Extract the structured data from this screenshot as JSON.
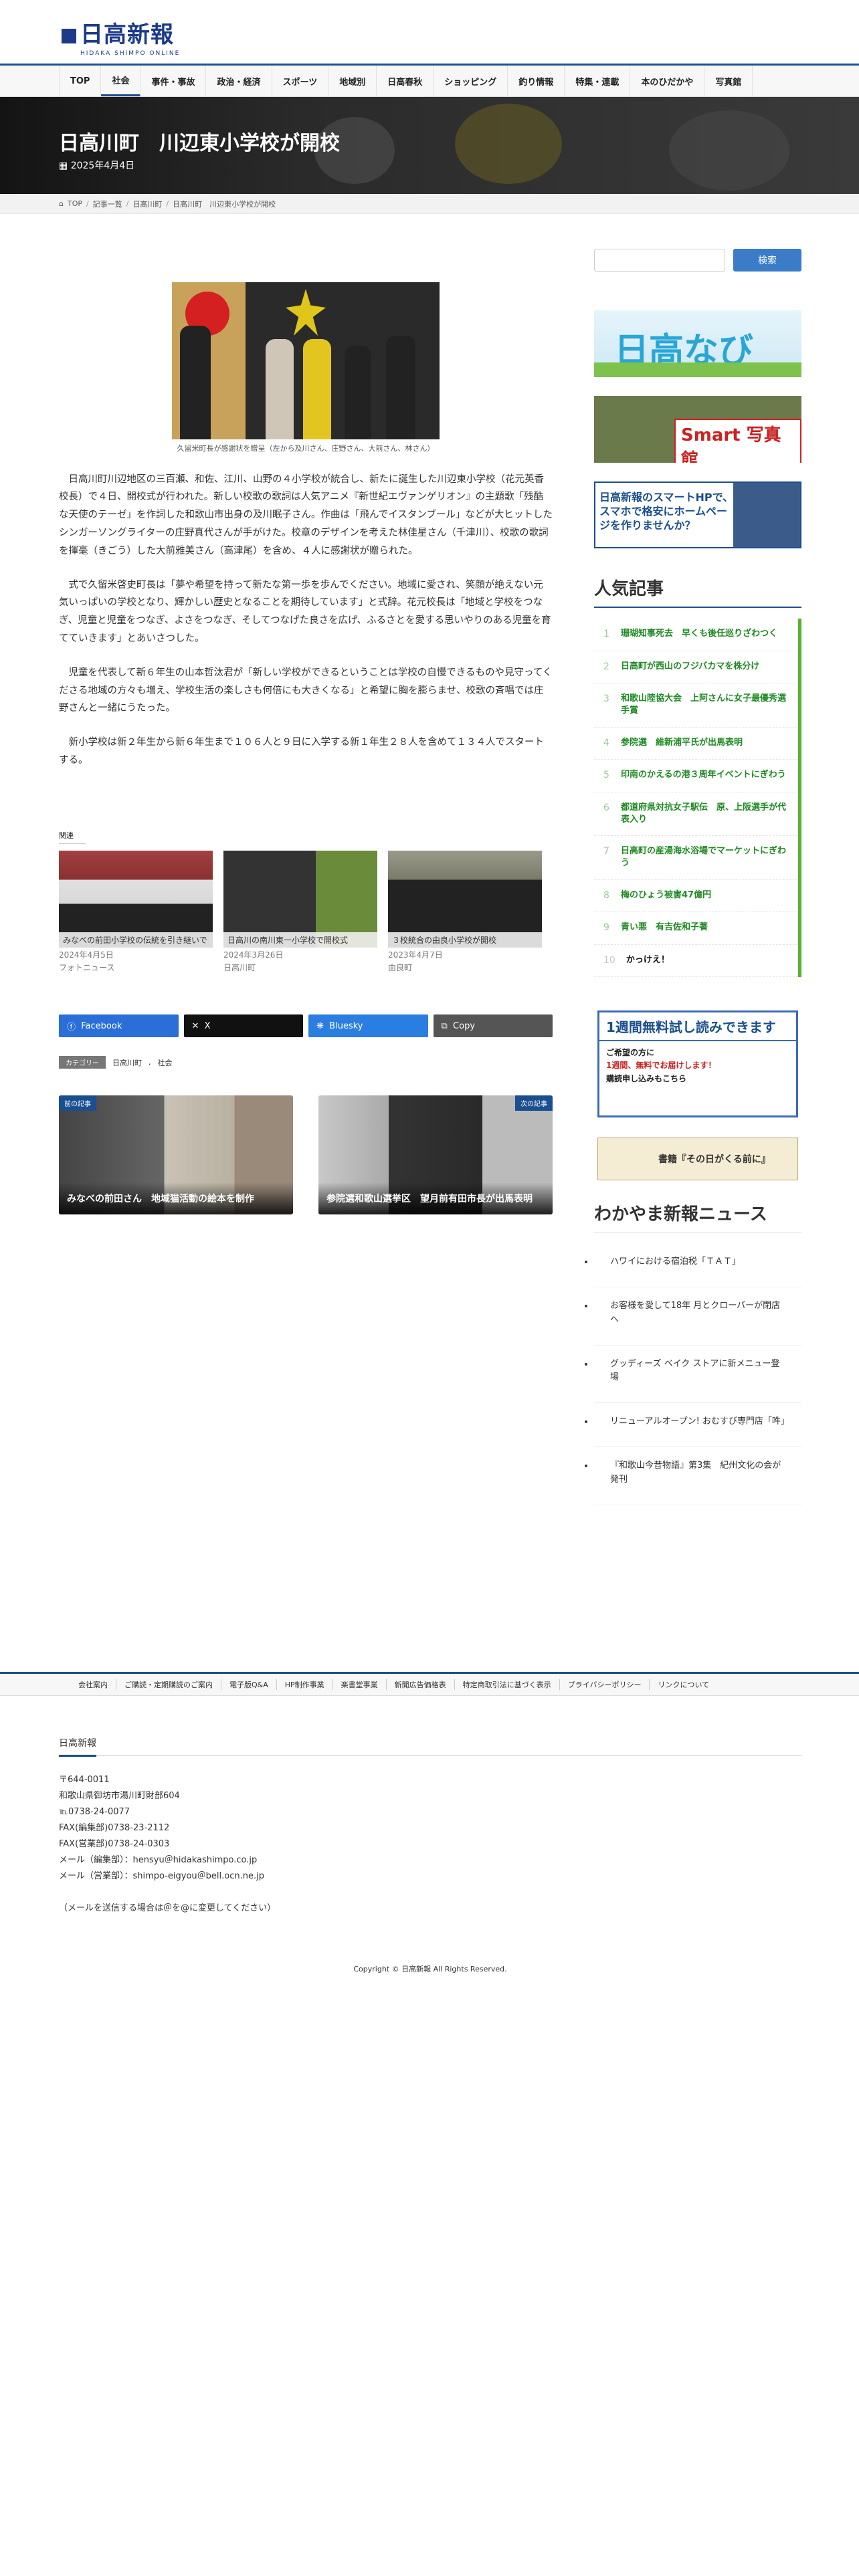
{
  "site": {
    "logo": "日高新報",
    "logo_sub": "HIDAKA SHIMPO ONLINE"
  },
  "nav": [
    "TOP",
    "社会",
    "事件・事故",
    "政治・経済",
    "スポーツ",
    "地域別",
    "日高春秋",
    "ショッピング",
    "釣り情報",
    "特集・連載",
    "本のひだかや",
    "写真館"
  ],
  "article": {
    "title": "日高川町　川辺東小学校が開校",
    "date": "2025年4月4日",
    "breadcrumb": [
      "TOP",
      "記事一覧",
      "日高川町",
      "日高川町　川辺東小学校が開校"
    ],
    "caption": "久留米町長が感謝状を贈呈（左から及川さん、庄野さん、大前さん、林さん）",
    "paragraphs": [
      "日高川町川辺地区の三百瀬、和佐、江川、山野の４小学校が統合し、新たに誕生した川辺東小学校（花元英香校長）で４日、開校式が行われた。新しい校歌の歌詞は人気アニメ『新世紀エヴァンゲリオン』の主題歌「残酷な天使のテーゼ」を作詞した和歌山市出身の及川眠子さん。作曲は「飛んでイスタンブール」などが大ヒットしたシンガーソングライターの庄野真代さんが手がけた。校章のデザインを考えた林佳星さん（千津川）、校歌の歌詞を揮毫（きごう）した大前雅美さん（高津尾）を含め、４人に感謝状が贈られた。",
      "式で久留米啓史町長は「夢や希望を持って新たな第一歩を歩んでください。地域に愛され、笑顔が絶えない元気いっぱいの学校となり、輝かしい歴史となることを期待しています」と式辞。花元校長は「地域と学校をつなぎ、児童と児童をつなぎ、よさをつなぎ、そしてつなげた良さを広げ、ふるさとを愛する思いやりのある児童を育てていきます」とあいさつした。",
      "児童を代表して新６年生の山本哲汰君が「新しい学校ができるということは学校の自慢できるものや見守ってくださる地域の方々も増え、学校生活の楽しさも何倍にも大きくなる」と希望に胸を膨らませ、校歌の斉唱では庄野さんと一緒にうたった。",
      "新小学校は新２年生から新６年生まで１０６人と９日に入学する新１年生２８人を含めて１３４人でスタートする。"
    ]
  },
  "related": {
    "heading": "関連",
    "items": [
      {
        "title": "みなべの前田小学校の伝統を引き継いで",
        "date": "2024年4月5日",
        "cat": "フォトニュース"
      },
      {
        "title": "日高川の南川東一小学校で開校式",
        "date": "2024年3月26日",
        "cat": "日高川町"
      },
      {
        "title": "３校統合の由良小学校が開校",
        "date": "2023年4月7日",
        "cat": "由良町"
      }
    ]
  },
  "share": [
    {
      "label": "Facebook",
      "color": "#2a6ed8",
      "icon": "facebook-icon"
    },
    {
      "label": "X",
      "color": "#111111",
      "icon": "x-icon"
    },
    {
      "label": "Bluesky",
      "color": "#2a7ee0",
      "icon": "bluesky-icon"
    },
    {
      "label": "Copy",
      "color": "#555555",
      "icon": "copy-icon"
    }
  ],
  "tags": {
    "label": "カテゴリー",
    "items": [
      "日高川町",
      "社会"
    ],
    "sep": ","
  },
  "prevnext": [
    {
      "badge": "前の記事",
      "title": "みなべの前田さん　地域猫活動の絵本を制作"
    },
    {
      "badge": "次の記事",
      "title": "参院選和歌山選挙区　望月前有田市長が出馬表明"
    }
  ],
  "sidebar": {
    "search_button": "検索",
    "banners": {
      "hidaka_navi": "日高なび",
      "photo": "Smart 写真館",
      "smart_hp": "日高新報のスマートHPで、スマホで格安にホームページを作りませんか？"
    },
    "popular_heading": "人気記事",
    "popular": [
      "珊瑚知事死去　早くも後任巡りざわつく",
      "日高町が西山のフジバカマを株分け",
      "和歌山陸協大会　上阿さんに女子最優秀選手賞",
      "参院選　維新浦平氏が出馬表明",
      "印南のかえるの港３周年イベントにぎわう",
      "都道府県対抗女子駅伝　原、上阪選手が代表入り",
      "日高町の産湯海水浴場でマーケットにぎわう",
      "梅のひょう被害47億円",
      "青い悪　有吉佐和子著",
      "かっけえ！"
    ],
    "trial": {
      "h": "1週間無料試し読みできます",
      "l1": "ご希望の方に",
      "l2": "1週間、無料でお届けします！",
      "l3": "購読申し込みもこちら"
    },
    "book": "書籍『その日がくる前に』",
    "wakayama_heading": "わかやま新報ニュース",
    "wakayama": [
      "ハワイにおける宿泊税「ＴＡＴ」",
      "お客様を愛して18年 月とクローバーが閉店へ",
      "グッディーズ ベイク ストアに新メニュー登場",
      "リニューアルオープン! おむすび専門店「吽」",
      "『和歌山今昔物語』第3集　紀州文化の会が発刊"
    ]
  },
  "footer": {
    "links": [
      "会社案内",
      "ご購読・定期購読のご案内",
      "電子版Q&A",
      "HP制作事業",
      "楽書堂事業",
      "新聞広告価格表",
      "特定商取引法に基づく表示",
      "プライバシーポリシー",
      "リンクについて"
    ],
    "name": "日高新報",
    "lines": [
      "〒644-0011",
      "和歌山県御坊市湯川町財部604",
      "℡0738-24-0077",
      "FAX(編集部)0738-23-2112",
      "FAX(営業部)0738-24-0303",
      "メール（編集部）：hensyu＠hidakashimpo.co.jp",
      "メール（営業部）：shimpo-eigyou＠bell.ocn.ne.jp",
      "",
      "（メールを送信する場合は＠を@に変更してください）"
    ],
    "copyright": "Copyright © 日高新報 All Rights Reserved."
  }
}
